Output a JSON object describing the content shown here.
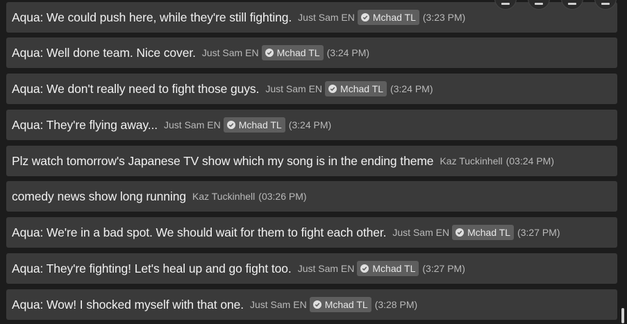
{
  "messages": [
    {
      "text": "Aqua: We could push here, while they're still fighting.",
      "author": "Just Sam EN",
      "badge": "Mchad TL",
      "time": "(3:23 PM)"
    },
    {
      "text": "Aqua: Well done team. Nice cover.",
      "author": "Just Sam EN",
      "badge": "Mchad TL",
      "time": "(3:24 PM)"
    },
    {
      "text": "Aqua: We don't really need to fight those guys.",
      "author": "Just Sam EN",
      "badge": "Mchad TL",
      "time": "(3:24 PM)"
    },
    {
      "text": "Aqua: They're flying away...",
      "author": "Just Sam EN",
      "badge": "Mchad TL",
      "time": "(3:24 PM)"
    },
    {
      "text": "Plz watch tomorrow's Japanese TV show which my song is in the ending theme",
      "author": "Kaz Tuckinhell",
      "badge": null,
      "time": "(03:24 PM)"
    },
    {
      "text": "comedy news show long running",
      "author": "Kaz Tuckinhell",
      "badge": null,
      "time": "(03:26 PM)"
    },
    {
      "text": "Aqua: We're in a bad spot. We should wait for them to fight each other.",
      "author": "Just Sam EN",
      "badge": "Mchad TL",
      "time": "(3:27 PM)"
    },
    {
      "text": "Aqua: They're fighting! Let's heal up and go fight too.",
      "author": "Just Sam EN",
      "badge": "Mchad TL",
      "time": "(3:27 PM)"
    },
    {
      "text": "Aqua: Wow! I shocked myself with that one.",
      "author": "Just Sam EN",
      "badge": "Mchad TL",
      "time": "(3:28 PM)"
    }
  ],
  "icons": {
    "badge_icon": "verified-check-icon",
    "overlay_buttons": [
      "toolbar-button-1-icon",
      "toolbar-button-2-icon",
      "toolbar-button-3-icon",
      "toolbar-button-4-icon"
    ]
  },
  "colors": {
    "row_background": "#3a3a3a",
    "page_background": "#1c1c1c",
    "badge_background": "#5e5e5e"
  }
}
